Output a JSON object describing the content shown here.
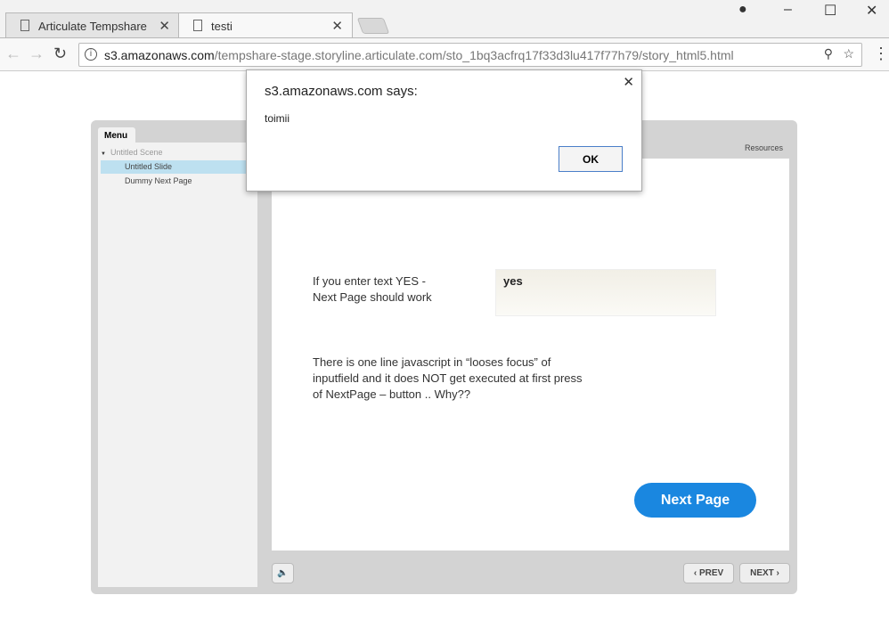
{
  "browser": {
    "tabs": [
      {
        "label": "Articulate Tempshare"
      },
      {
        "label": "testi"
      }
    ],
    "url_host": "s3.amazonaws.com",
    "url_path": "/tempshare-stage.storyline.articulate.com/sto_1bq3acfrq17f33d3lu417f77h79/story_html5.html"
  },
  "player": {
    "menu_tab": "Menu",
    "resources": "Resources",
    "menu_items": [
      {
        "label": "Untitled Scene"
      },
      {
        "label": "Untitled Slide"
      },
      {
        "label": "Dummy Next Page"
      }
    ],
    "prev": "PREV",
    "next": "NEXT"
  },
  "slide": {
    "prompt_line1": "If you enter text YES -",
    "prompt_line2": "Next Page should work",
    "input_value": "yes",
    "note_line1": "There is one line javascript in “looses focus” of",
    "note_line2": "inputfield and it does NOT get executed at first press",
    "note_line3": "of NextPage – button .. Why??",
    "next_page_button": "Next Page"
  },
  "dialog": {
    "title": "s3.amazonaws.com says:",
    "message": "toimii",
    "ok": "OK"
  }
}
